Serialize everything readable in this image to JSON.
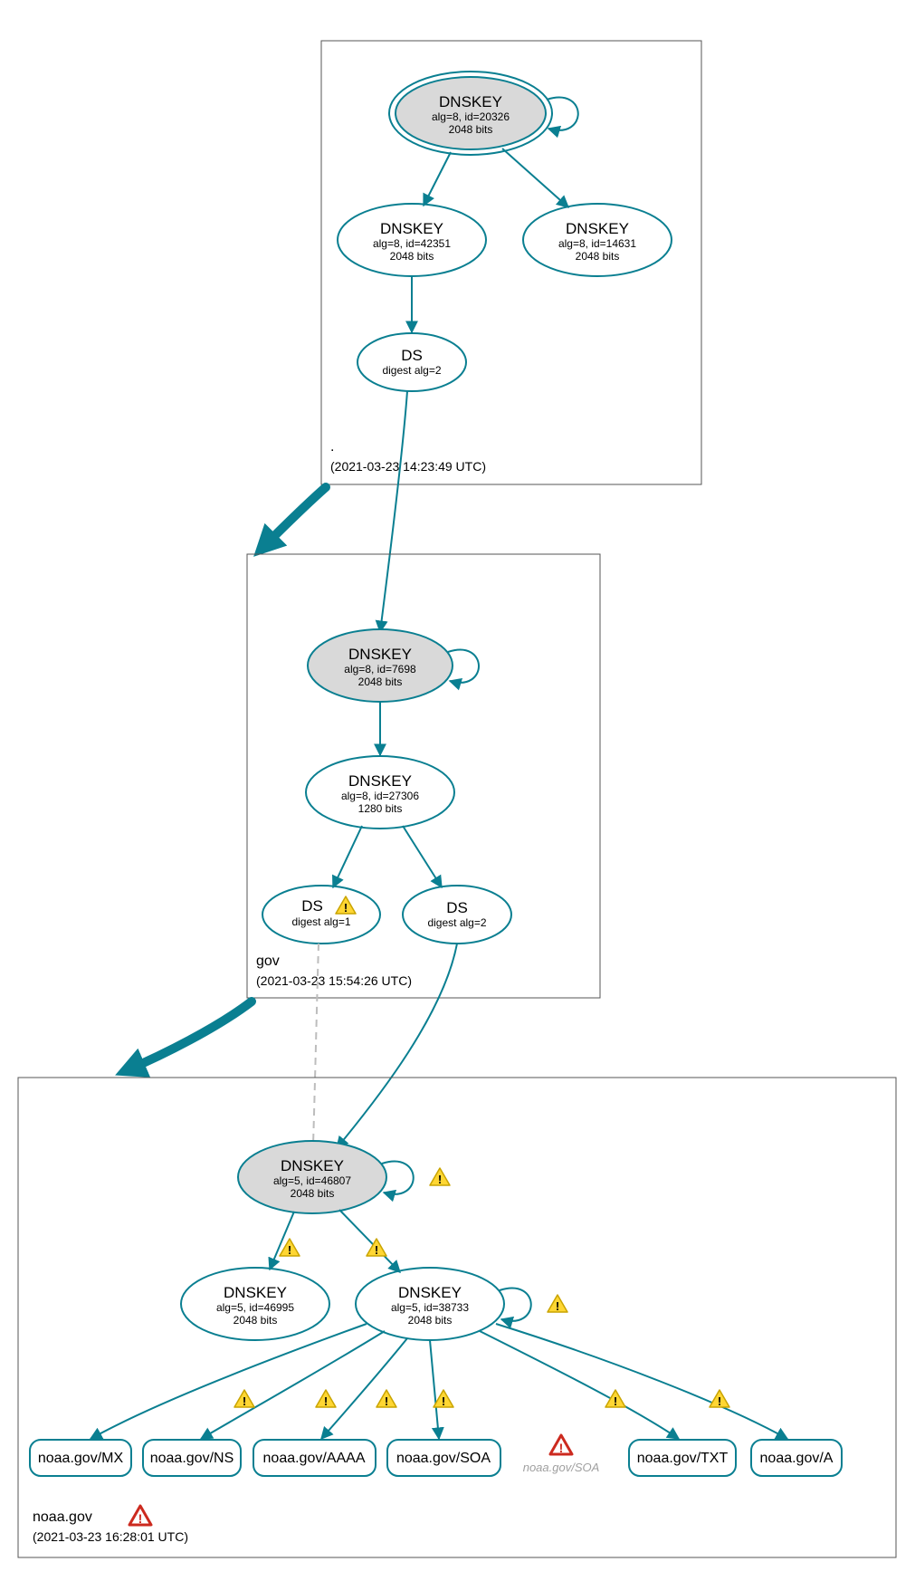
{
  "zones": {
    "root": {
      "label": ".",
      "timestamp": "(2021-03-23 14:23:49 UTC)"
    },
    "gov": {
      "label": "gov",
      "timestamp": "(2021-03-23 15:54:26 UTC)"
    },
    "noaa": {
      "label": "noaa.gov",
      "timestamp": "(2021-03-23 16:28:01 UTC)"
    }
  },
  "nodes": {
    "root_ksk": {
      "title": "DNSKEY",
      "line2": "alg=8, id=20326",
      "line3": "2048 bits"
    },
    "root_zsk1": {
      "title": "DNSKEY",
      "line2": "alg=8, id=42351",
      "line3": "2048 bits"
    },
    "root_zsk2": {
      "title": "DNSKEY",
      "line2": "alg=8, id=14631",
      "line3": "2048 bits"
    },
    "root_ds": {
      "title": "DS",
      "line2": "digest alg=2",
      "line3": ""
    },
    "gov_ksk": {
      "title": "DNSKEY",
      "line2": "alg=8, id=7698",
      "line3": "2048 bits"
    },
    "gov_zsk": {
      "title": "DNSKEY",
      "line2": "alg=8, id=27306",
      "line3": "1280 bits"
    },
    "gov_ds1": {
      "title": "DS",
      "line2": "digest alg=1",
      "line3": ""
    },
    "gov_ds2": {
      "title": "DS",
      "line2": "digest alg=2",
      "line3": ""
    },
    "noaa_ksk": {
      "title": "DNSKEY",
      "line2": "alg=5, id=46807",
      "line3": "2048 bits"
    },
    "noaa_k2": {
      "title": "DNSKEY",
      "line2": "alg=5, id=46995",
      "line3": "2048 bits"
    },
    "noaa_zsk": {
      "title": "DNSKEY",
      "line2": "alg=5, id=38733",
      "line3": "2048 bits"
    }
  },
  "records": {
    "mx": "noaa.gov/MX",
    "ns": "noaa.gov/NS",
    "aaaa": "noaa.gov/AAAA",
    "soa": "noaa.gov/SOA",
    "soa2": "noaa.gov/SOA",
    "txt": "noaa.gov/TXT",
    "a": "noaa.gov/A"
  }
}
